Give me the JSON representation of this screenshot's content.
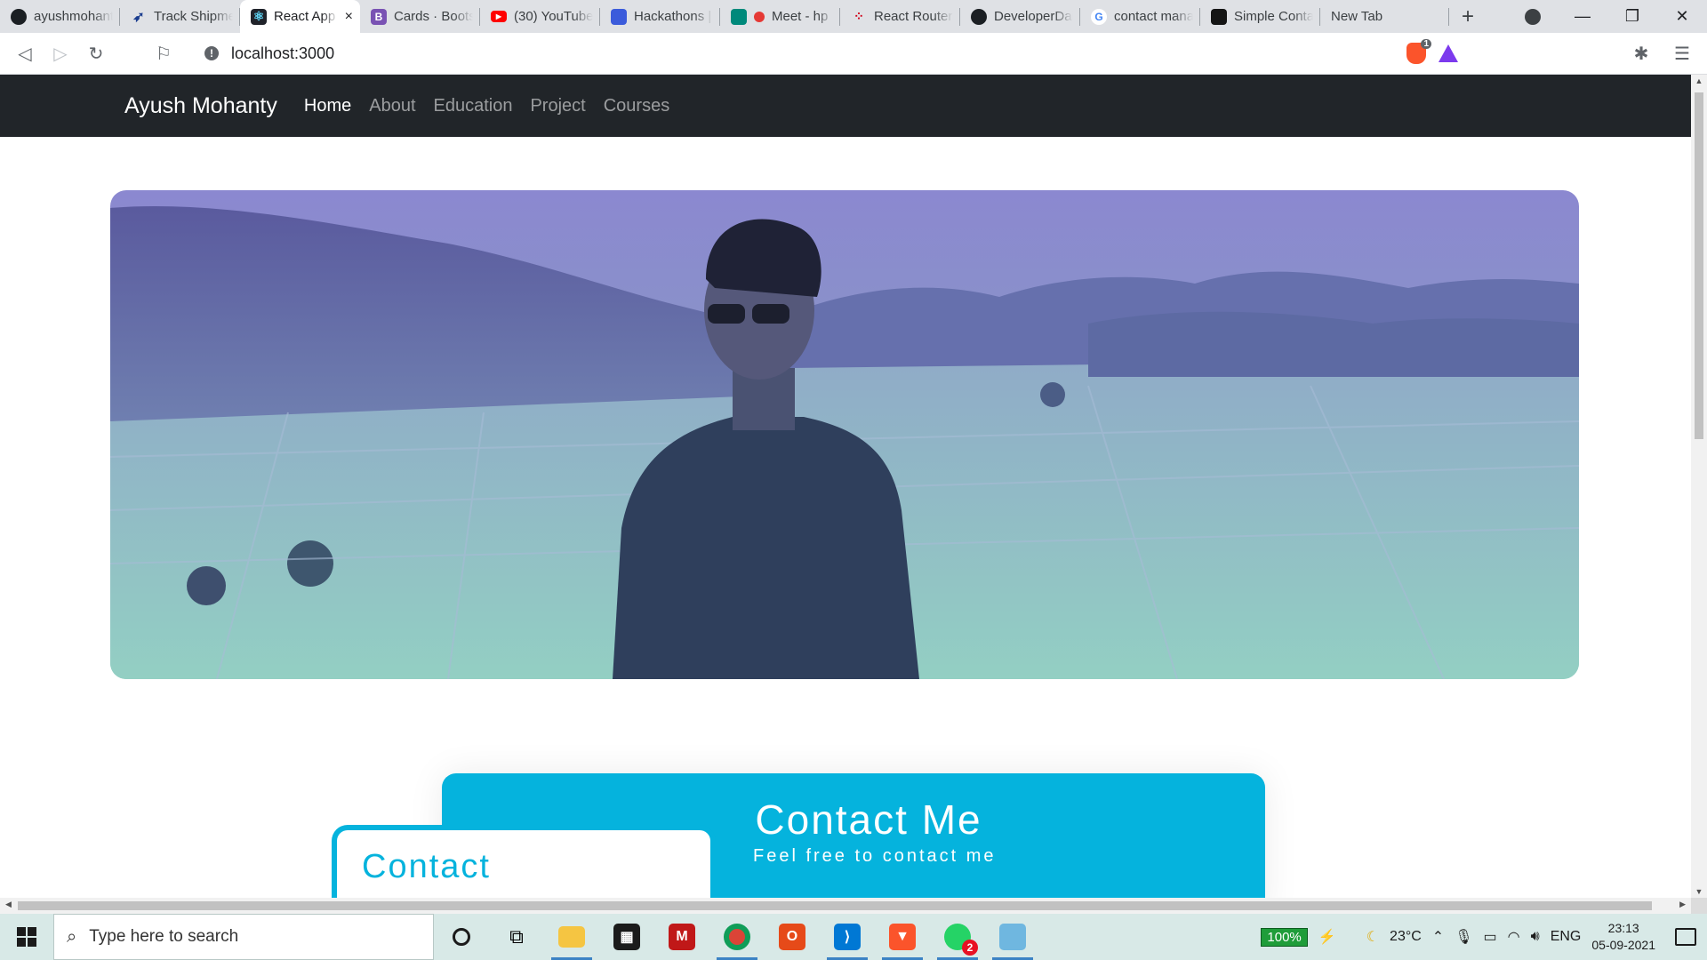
{
  "browser": {
    "tabs": [
      {
        "title": "ayushmohanty",
        "icon": "github-icon",
        "color": "#1b1f23"
      },
      {
        "title": "Track Shipment",
        "icon": "runner-icon",
        "color": "#1a3d8f"
      },
      {
        "title": "React App",
        "icon": "react-icon",
        "color": "#20232a",
        "active": true
      },
      {
        "title": "Cards · Bootstrap",
        "icon": "bootstrap-icon",
        "color": "#7952b3"
      },
      {
        "title": "(30) YouTube",
        "icon": "youtube-icon",
        "color": "#ff0000"
      },
      {
        "title": "Hackathons |",
        "icon": "devpost-icon",
        "color": "#3b5bdb"
      },
      {
        "title": "Meet - hp",
        "icon": "meet-icon",
        "color": "#00897b"
      },
      {
        "title": "React Router",
        "icon": "react-router-icon",
        "color": "#d0021b"
      },
      {
        "title": "DeveloperDairy",
        "icon": "github-icon",
        "color": "#1b1f23"
      },
      {
        "title": "contact manager",
        "icon": "google-icon",
        "color": "#4285f4"
      },
      {
        "title": "Simple Contact",
        "icon": "codesandbox-icon",
        "color": "#151515"
      },
      {
        "title": "New Tab",
        "icon": "",
        "color": ""
      }
    ],
    "close_glyph": "×",
    "new_tab_glyph": "+",
    "url": "localhost:3000",
    "shields_count": "1"
  },
  "page": {
    "brand": "Ayush Mohanty",
    "nav": [
      "Home",
      "About",
      "Education",
      "Project",
      "Courses"
    ],
    "active_nav": "Home",
    "contact_title": "Contact Me",
    "contact_subtitle": "Feel free to contact me",
    "contact_form_title": "Contact",
    "accent_color": "#05b3dd"
  },
  "taskbar": {
    "search_placeholder": "Type here to search",
    "battery": "100%",
    "weather": "23°C",
    "language": "ENG",
    "time": "23:13",
    "date": "05-09-2021",
    "notification_badge": "2"
  }
}
